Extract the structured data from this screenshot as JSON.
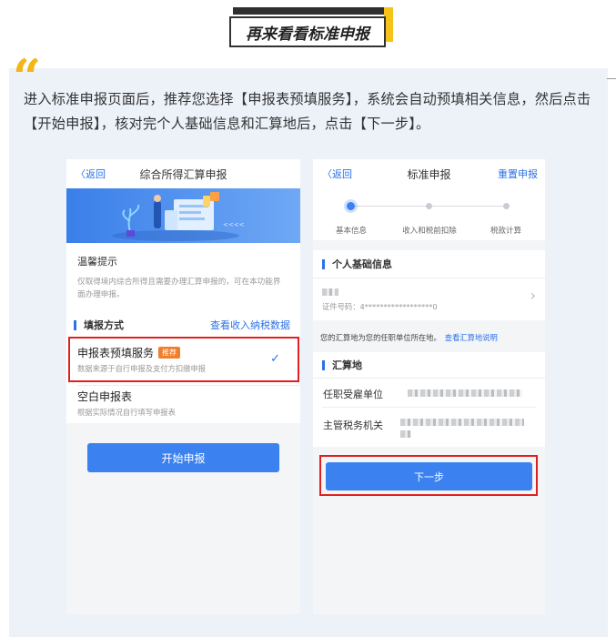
{
  "section_title": "再来看看标准申报",
  "quote_mark": "“",
  "intro_text": "进入标准申报页面后，推荐您选择【申报表预填服务】，系统会自动预填相关信息，然后点击【开始申报】，核对完个人基础信息和汇算地后，点击【下一步】。",
  "left_screen": {
    "back": "〈返回",
    "title": "综合所得汇算申报",
    "banner_text": "<<<<",
    "tips_title": "温馨提示",
    "tips_body": "仅取得境内综合所得且需要办理汇算申报的，可在本功能界面办理申报。",
    "method_title": "填报方式",
    "method_link": "查看收入纳税数据",
    "option1_title": "申报表预填服务",
    "option1_badge": "推荐",
    "option1_desc": "数据来源于自行申报及支付方扣缴申报",
    "check": "✓",
    "option2_title": "空白申报表",
    "option2_desc": "根据实际情况自行填写申报表",
    "start_button": "开始申报"
  },
  "right_screen": {
    "back": "〈返回",
    "title": "标准申报",
    "reset": "重置申报",
    "steps": [
      "基本信息",
      "收入和税前扣除",
      "税款计算"
    ],
    "personal_title": "个人基础信息",
    "id_label": "证件号码：4******************0",
    "chevron": "›",
    "notice": "您的汇算地为您的任职单位所在地。",
    "notice_link": "查看汇算地说明",
    "settle_title": "汇算地",
    "employer_label": "任职受雇单位",
    "tax_office_label": "主管税务机关",
    "next_button": "下一步"
  },
  "colors": {
    "accent_blue": "#3b82f0",
    "highlight_red": "#e02020",
    "quote_yellow": "#f5b514",
    "panel_bg": "#edf2f9"
  }
}
